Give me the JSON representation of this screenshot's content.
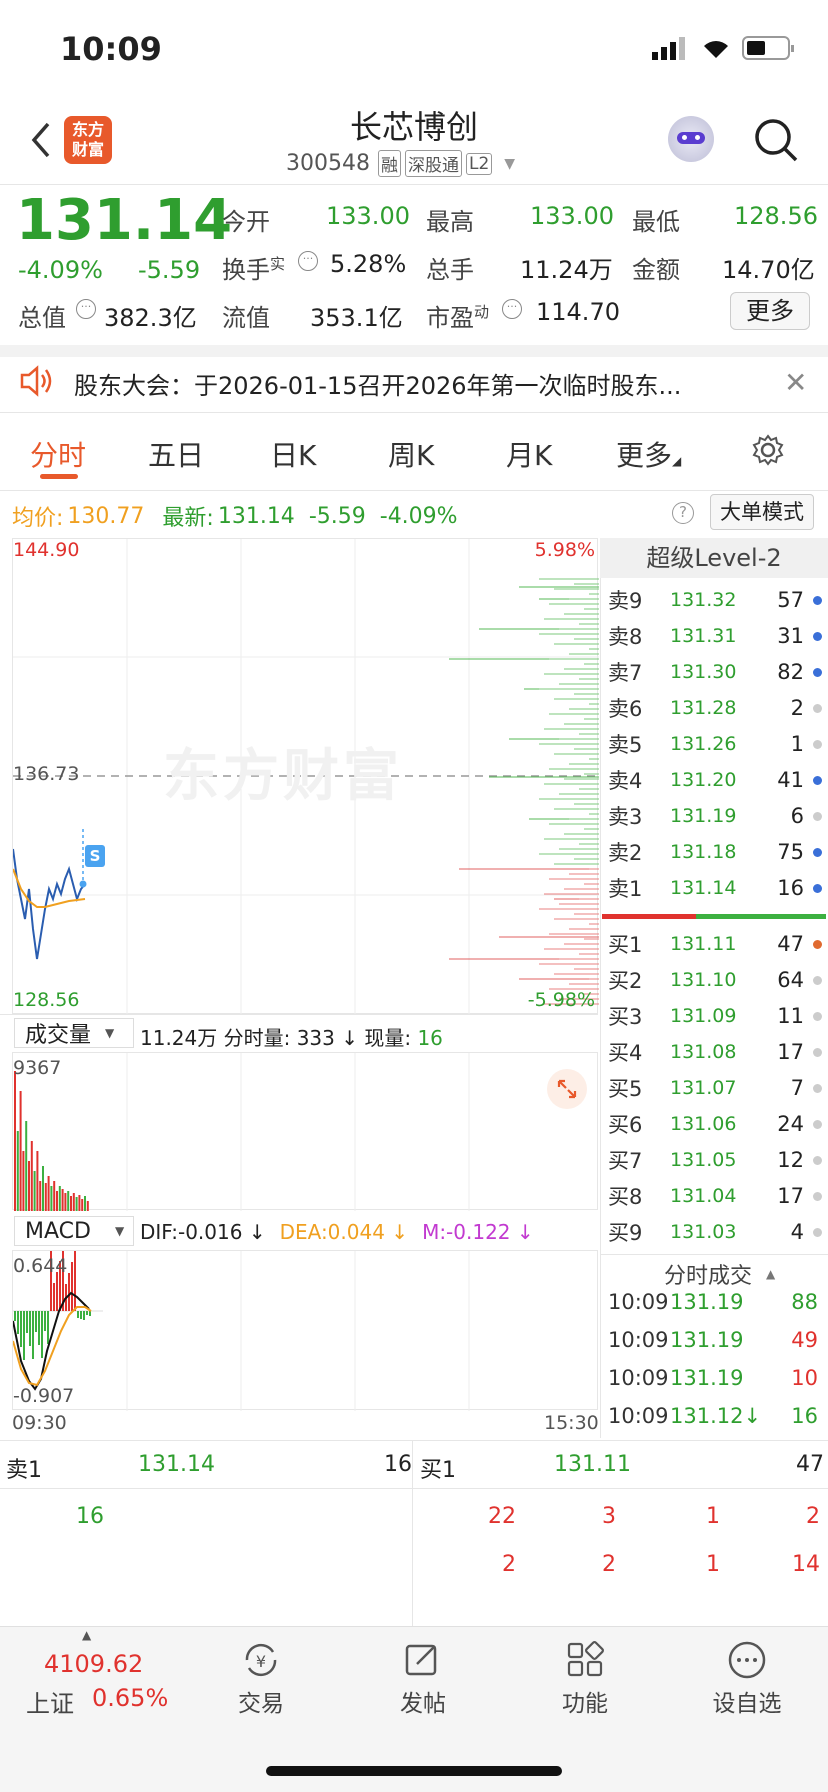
{
  "status": {
    "time": "10:09"
  },
  "header": {
    "title": "长芯博创",
    "code": "300548",
    "tags": [
      "融",
      "深股通",
      "L2"
    ],
    "logo_lines": [
      "东方",
      "财富"
    ]
  },
  "quote": {
    "price": "131.14",
    "pct": "-4.09%",
    "chg": "-5.59",
    "stats": [
      {
        "label": "今开",
        "value": "133.00"
      },
      {
        "label": "最高",
        "value": "133.00"
      },
      {
        "label": "最低",
        "value": "128.56"
      },
      {
        "label": "换手",
        "sup": "实",
        "value": "5.28%"
      },
      {
        "label": "总手",
        "value": "11.24万"
      },
      {
        "label": "金额",
        "value": "14.70亿"
      },
      {
        "label": "总值",
        "value": "382.3亿"
      },
      {
        "label": "流值",
        "value": "353.1亿"
      },
      {
        "label": "市盈",
        "sup": "动",
        "value": "114.70"
      }
    ],
    "more_label": "更多"
  },
  "notice": {
    "text": "股东大会：于2026-01-15召开2026年第一次临时股东..."
  },
  "tabs": [
    "分时",
    "五日",
    "日K",
    "周K",
    "月K",
    "更多"
  ],
  "info_line": {
    "avg_label": "均价:",
    "avg": "130.77",
    "latest_label": "最新:",
    "latest": "131.14",
    "chg": "-5.59",
    "pct": "-4.09%",
    "mode_btn": "大单模式"
  },
  "chart": {
    "high": "144.90",
    "mid": "136.73",
    "low": "128.56",
    "pct_high": "5.98%",
    "pct_low": "-5.98%",
    "watermark": "东方财富",
    "marker": "S"
  },
  "volume": {
    "selector": "成交量",
    "summary": "11.24万 分时量: 333 ↓ 现量:",
    "now_vol": "16",
    "max": "9367"
  },
  "macd": {
    "selector": "MACD",
    "dif": "DIF:-0.016 ↓",
    "dea": "DEA:0.044 ↓",
    "m": "M:-0.122 ↓",
    "top": "0.644",
    "bottom": "-0.907",
    "start": "09:30",
    "end": "15:30"
  },
  "orderbook": {
    "title": "超级Level-2",
    "asks": [
      {
        "label": "卖9",
        "price": "131.32",
        "qty": "57",
        "dot": "#3a6fd8"
      },
      {
        "label": "卖8",
        "price": "131.31",
        "qty": "31",
        "dot": "#3a6fd8"
      },
      {
        "label": "卖7",
        "price": "131.30",
        "qty": "82",
        "dot": "#3a6fd8"
      },
      {
        "label": "卖6",
        "price": "131.28",
        "qty": "2",
        "dot": "#cccccc"
      },
      {
        "label": "卖5",
        "price": "131.26",
        "qty": "1",
        "dot": "#cccccc"
      },
      {
        "label": "卖4",
        "price": "131.20",
        "qty": "41",
        "dot": "#3a6fd8"
      },
      {
        "label": "卖3",
        "price": "131.19",
        "qty": "6",
        "dot": "#cccccc"
      },
      {
        "label": "卖2",
        "price": "131.18",
        "qty": "75",
        "dot": "#3a6fd8"
      },
      {
        "label": "卖1",
        "price": "131.14",
        "qty": "16",
        "dot": "#3a6fd8"
      }
    ],
    "bids": [
      {
        "label": "买1",
        "price": "131.11",
        "qty": "47",
        "dot": "#e06a30"
      },
      {
        "label": "买2",
        "price": "131.10",
        "qty": "64",
        "dot": "#cccccc"
      },
      {
        "label": "买3",
        "price": "131.09",
        "qty": "11",
        "dot": "#cccccc"
      },
      {
        "label": "买4",
        "price": "131.08",
        "qty": "17",
        "dot": "#cccccc"
      },
      {
        "label": "买5",
        "price": "131.07",
        "qty": "7",
        "dot": "#cccccc"
      },
      {
        "label": "买6",
        "price": "131.06",
        "qty": "24",
        "dot": "#cccccc"
      },
      {
        "label": "买7",
        "price": "131.05",
        "qty": "12",
        "dot": "#cccccc"
      },
      {
        "label": "买8",
        "price": "131.04",
        "qty": "17",
        "dot": "#cccccc"
      },
      {
        "label": "买9",
        "price": "131.03",
        "qty": "4",
        "dot": "#cccccc"
      }
    ]
  },
  "trades": {
    "title": "分时成交",
    "rows": [
      {
        "time": "10:09",
        "price": "131.19",
        "qty": "88",
        "color": "#2f9e2f"
      },
      {
        "time": "10:09",
        "price": "131.19",
        "qty": "49",
        "color": "#e0322e"
      },
      {
        "time": "10:09",
        "price": "131.19",
        "qty": "10",
        "color": "#e0322e"
      },
      {
        "time": "10:09",
        "price": "131.12↓",
        "qty": "16",
        "color": "#2f9e2f"
      }
    ]
  },
  "queue": {
    "sell_label": "卖1",
    "sell_price": "131.14",
    "sell_qty": "16",
    "buy_label": "买1",
    "buy_price": "131.11",
    "buy_qty": "47",
    "sell_items": [
      "16"
    ],
    "buy_row1": [
      "22",
      "3",
      "1",
      "2"
    ],
    "buy_row2": [
      "2",
      "2",
      "1",
      "14"
    ]
  },
  "bottom": {
    "index_value": "4109.62",
    "index_name": "上证",
    "index_pct": "0.65%",
    "nav": [
      {
        "label": "交易",
        "icon": "trade-icon"
      },
      {
        "label": "发帖",
        "icon": "post-icon"
      },
      {
        "label": "功能",
        "icon": "apps-icon"
      },
      {
        "label": "设自选",
        "icon": "more-icon"
      }
    ]
  }
}
